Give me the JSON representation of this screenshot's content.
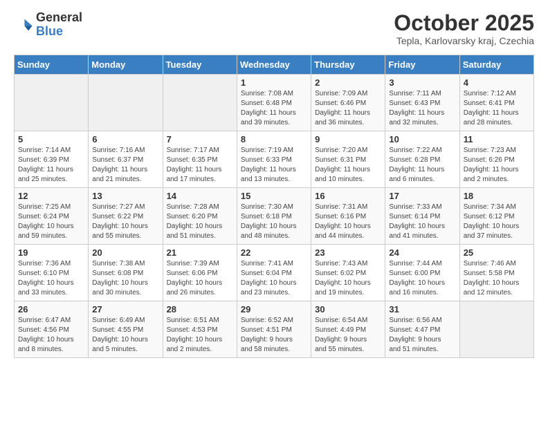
{
  "header": {
    "logo_general": "General",
    "logo_blue": "Blue",
    "month_title": "October 2025",
    "subtitle": "Tepla, Karlovarsky kraj, Czechia"
  },
  "weekdays": [
    "Sunday",
    "Monday",
    "Tuesday",
    "Wednesday",
    "Thursday",
    "Friday",
    "Saturday"
  ],
  "weeks": [
    [
      {
        "day": "",
        "info": ""
      },
      {
        "day": "",
        "info": ""
      },
      {
        "day": "",
        "info": ""
      },
      {
        "day": "1",
        "info": "Sunrise: 7:08 AM\nSunset: 6:48 PM\nDaylight: 11 hours\nand 39 minutes."
      },
      {
        "day": "2",
        "info": "Sunrise: 7:09 AM\nSunset: 6:46 PM\nDaylight: 11 hours\nand 36 minutes."
      },
      {
        "day": "3",
        "info": "Sunrise: 7:11 AM\nSunset: 6:43 PM\nDaylight: 11 hours\nand 32 minutes."
      },
      {
        "day": "4",
        "info": "Sunrise: 7:12 AM\nSunset: 6:41 PM\nDaylight: 11 hours\nand 28 minutes."
      }
    ],
    [
      {
        "day": "5",
        "info": "Sunrise: 7:14 AM\nSunset: 6:39 PM\nDaylight: 11 hours\nand 25 minutes."
      },
      {
        "day": "6",
        "info": "Sunrise: 7:16 AM\nSunset: 6:37 PM\nDaylight: 11 hours\nand 21 minutes."
      },
      {
        "day": "7",
        "info": "Sunrise: 7:17 AM\nSunset: 6:35 PM\nDaylight: 11 hours\nand 17 minutes."
      },
      {
        "day": "8",
        "info": "Sunrise: 7:19 AM\nSunset: 6:33 PM\nDaylight: 11 hours\nand 13 minutes."
      },
      {
        "day": "9",
        "info": "Sunrise: 7:20 AM\nSunset: 6:31 PM\nDaylight: 11 hours\nand 10 minutes."
      },
      {
        "day": "10",
        "info": "Sunrise: 7:22 AM\nSunset: 6:28 PM\nDaylight: 11 hours\nand 6 minutes."
      },
      {
        "day": "11",
        "info": "Sunrise: 7:23 AM\nSunset: 6:26 PM\nDaylight: 11 hours\nand 2 minutes."
      }
    ],
    [
      {
        "day": "12",
        "info": "Sunrise: 7:25 AM\nSunset: 6:24 PM\nDaylight: 10 hours\nand 59 minutes."
      },
      {
        "day": "13",
        "info": "Sunrise: 7:27 AM\nSunset: 6:22 PM\nDaylight: 10 hours\nand 55 minutes."
      },
      {
        "day": "14",
        "info": "Sunrise: 7:28 AM\nSunset: 6:20 PM\nDaylight: 10 hours\nand 51 minutes."
      },
      {
        "day": "15",
        "info": "Sunrise: 7:30 AM\nSunset: 6:18 PM\nDaylight: 10 hours\nand 48 minutes."
      },
      {
        "day": "16",
        "info": "Sunrise: 7:31 AM\nSunset: 6:16 PM\nDaylight: 10 hours\nand 44 minutes."
      },
      {
        "day": "17",
        "info": "Sunrise: 7:33 AM\nSunset: 6:14 PM\nDaylight: 10 hours\nand 41 minutes."
      },
      {
        "day": "18",
        "info": "Sunrise: 7:34 AM\nSunset: 6:12 PM\nDaylight: 10 hours\nand 37 minutes."
      }
    ],
    [
      {
        "day": "19",
        "info": "Sunrise: 7:36 AM\nSunset: 6:10 PM\nDaylight: 10 hours\nand 33 minutes."
      },
      {
        "day": "20",
        "info": "Sunrise: 7:38 AM\nSunset: 6:08 PM\nDaylight: 10 hours\nand 30 minutes."
      },
      {
        "day": "21",
        "info": "Sunrise: 7:39 AM\nSunset: 6:06 PM\nDaylight: 10 hours\nand 26 minutes."
      },
      {
        "day": "22",
        "info": "Sunrise: 7:41 AM\nSunset: 6:04 PM\nDaylight: 10 hours\nand 23 minutes."
      },
      {
        "day": "23",
        "info": "Sunrise: 7:43 AM\nSunset: 6:02 PM\nDaylight: 10 hours\nand 19 minutes."
      },
      {
        "day": "24",
        "info": "Sunrise: 7:44 AM\nSunset: 6:00 PM\nDaylight: 10 hours\nand 16 minutes."
      },
      {
        "day": "25",
        "info": "Sunrise: 7:46 AM\nSunset: 5:58 PM\nDaylight: 10 hours\nand 12 minutes."
      }
    ],
    [
      {
        "day": "26",
        "info": "Sunrise: 6:47 AM\nSunset: 4:56 PM\nDaylight: 10 hours\nand 8 minutes."
      },
      {
        "day": "27",
        "info": "Sunrise: 6:49 AM\nSunset: 4:55 PM\nDaylight: 10 hours\nand 5 minutes."
      },
      {
        "day": "28",
        "info": "Sunrise: 6:51 AM\nSunset: 4:53 PM\nDaylight: 10 hours\nand 2 minutes."
      },
      {
        "day": "29",
        "info": "Sunrise: 6:52 AM\nSunset: 4:51 PM\nDaylight: 9 hours\nand 58 minutes."
      },
      {
        "day": "30",
        "info": "Sunrise: 6:54 AM\nSunset: 4:49 PM\nDaylight: 9 hours\nand 55 minutes."
      },
      {
        "day": "31",
        "info": "Sunrise: 6:56 AM\nSunset: 4:47 PM\nDaylight: 9 hours\nand 51 minutes."
      },
      {
        "day": "",
        "info": ""
      }
    ]
  ]
}
